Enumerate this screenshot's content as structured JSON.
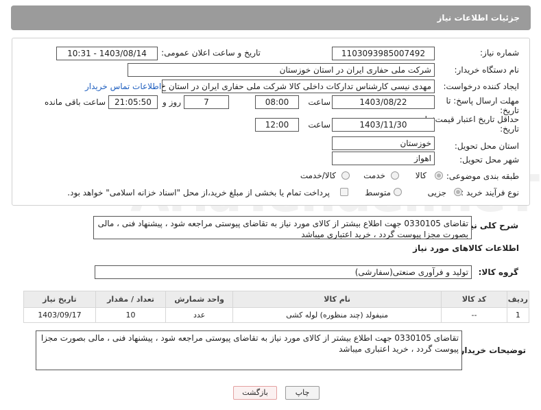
{
  "header": {
    "title": "جزئیات اطلاعات نیاز"
  },
  "fields": {
    "need_number": {
      "label": "شماره نیاز:",
      "value": "1103093985007492"
    },
    "announce_datetime": {
      "label": "تاریخ و ساعت اعلان عمومی:",
      "value": "1403/08/14 - 10:31"
    },
    "buyer_org": {
      "label": "نام دستگاه خریدار:",
      "value": "شرکت ملی حفاری ایران در استان خوزستان"
    },
    "requester": {
      "label": "ایجاد کننده درخواست:",
      "value": "مهدی نیسی کارشناس تدارکات داخلی کالا شرکت ملی حفاری ایران در استان خ",
      "contact_link": "اطلاعات تماس خریدار"
    },
    "reply_deadline": {
      "label_line1": "مهلت ارسال پاسخ: تا",
      "label_line2": "تاریخ:",
      "date": "1403/08/22",
      "time_label": "ساعت",
      "time": "08:00",
      "days": "7",
      "days_label": "روز و",
      "remaining": "21:05:50",
      "remaining_label": "ساعت باقی مانده"
    },
    "price_validity": {
      "label_line1": "حداقل تاریخ اعتبار قیمت: تا",
      "label_line2": "تاریخ:",
      "date": "1403/11/30",
      "time_label": "ساعت",
      "time": "12:00"
    },
    "delivery_province": {
      "label": "استان محل تحویل:",
      "value": "خوزستان"
    },
    "delivery_city": {
      "label": "شهر محل تحویل:",
      "value": "اهواز"
    },
    "category": {
      "label": "طبقه بندی موضوعی:",
      "options": [
        "کالا",
        "خدمت",
        "کالا/خدمت"
      ],
      "selected": "کالا"
    },
    "purchase_type": {
      "label": "نوع فرآیند خرید :",
      "options": [
        "جزیی",
        "متوسط"
      ],
      "selected": "جزیی",
      "checkbox_text": "پرداخت تمام یا بخشی از مبلغ خرید،از محل \"اسناد خزانه اسلامی\" خواهد بود."
    }
  },
  "description": {
    "label": "شرح کلی نیاز:",
    "value": "تقاضای 0330105 جهت اطلاع بیشتر از کالای مورد نیاز به تقاضای پیوستی مراجعه شود ، پیشنهاد فنی ، مالی بصورت مجزا پیوست گردد ، خرید اعتباری میباشد"
  },
  "goods_section": {
    "title": "اطلاعات کالاهای مورد نیاز",
    "group_label": "گروه کالا:",
    "group_value": "تولید و فرآوری صنعتی(سفارشی)",
    "columns": [
      "ردیف",
      "کد کالا",
      "نام کالا",
      "واحد شمارش",
      "تعداد / مقدار",
      "تاریخ نیاز"
    ],
    "rows": [
      {
        "row": "1",
        "code": "--",
        "name": "منیفولد (چند منظوره) لوله کشی",
        "unit": "عدد",
        "qty": "10",
        "date": "1403/09/17"
      }
    ]
  },
  "buyer_notes": {
    "label": "توضیحات خریدار:",
    "value": "تقاضای 0330105 جهت اطلاع بیشتر از کالای مورد نیاز به تقاضای پیوستی مراجعه شود ، پیشنهاد فنی ، مالی بصورت مجزا پیوست گردد ، خرید اعتباری میباشد"
  },
  "buttons": {
    "print": "چاپ",
    "back": "بازگشت"
  },
  "watermark": {
    "text": "AriaTender.neT"
  },
  "colors": {
    "header_bg": "#9b9b9b",
    "link": "#1f5fbf",
    "back_button_border": "#e3a0a0"
  }
}
